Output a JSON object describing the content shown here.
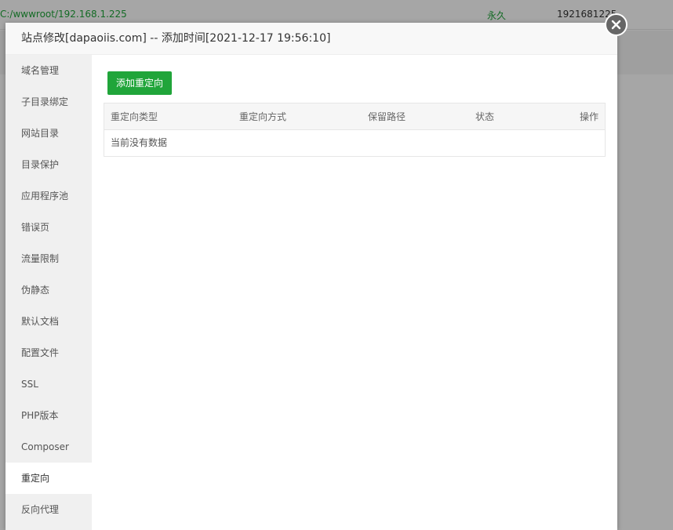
{
  "background": {
    "path": "C:/wwwroot/192.168.1.225",
    "expire": "永久",
    "remark": "1921681225"
  },
  "modal": {
    "title": "站点修改[dapaoiis.com] -- 添加时间[2021-12-17 19:56:10]",
    "close_icon": "close-circle-icon"
  },
  "sidebar": {
    "items": [
      {
        "label": "域名管理"
      },
      {
        "label": "子目录绑定"
      },
      {
        "label": "网站目录"
      },
      {
        "label": "目录保护"
      },
      {
        "label": "应用程序池"
      },
      {
        "label": "错误页"
      },
      {
        "label": "流量限制"
      },
      {
        "label": "伪静态"
      },
      {
        "label": "默认文档"
      },
      {
        "label": "配置文件"
      },
      {
        "label": "SSL"
      },
      {
        "label": "PHP版本"
      },
      {
        "label": "Composer"
      },
      {
        "label": "重定向"
      },
      {
        "label": "反向代理"
      }
    ],
    "active_index": 13
  },
  "content": {
    "add_button": "添加重定向",
    "table": {
      "headers": [
        "重定向类型",
        "重定向方式",
        "保留路径",
        "状态",
        "操作"
      ],
      "empty_text": "当前没有数据"
    }
  },
  "colors": {
    "accent": "#20a53a",
    "overlay": "#a7a7a7"
  }
}
